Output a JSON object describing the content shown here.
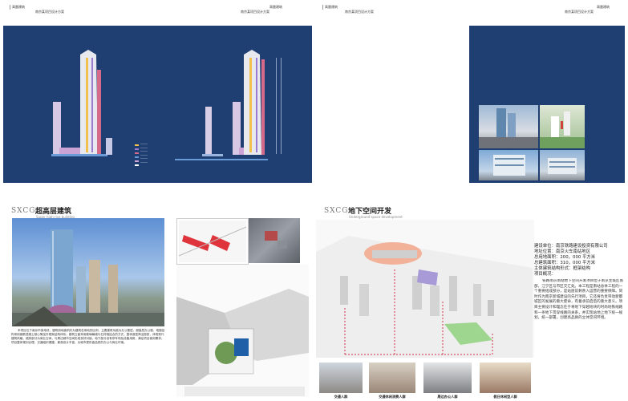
{
  "pages": {
    "elevation": {
      "header_left": "高層建筑",
      "header_right": "高層建筑",
      "header_note": "南京某项目设计方案",
      "legend": [
        "一一一",
        "一一一",
        "一一一",
        "一一一",
        "一一一",
        "一一一"
      ]
    },
    "renderings": {
      "header_left": "高層建筑",
      "header_right": "高層建筑",
      "header_note": "南京某项目设计方案"
    },
    "highrise": {
      "logo": "SXCG",
      "title": "超高层建筑",
      "subtitle": "Super high-rise building",
      "text": "本项目位于南京市某地块，建筑用地面积约为建筑总用地的比例，主要建筑功能为办公楼层。超高层办公楼，塔楼结构采用钢筋混凝土核心筒加外框架结构体系。建筑立面采用玻璃幕墙与石材相结合的方式，整体造型简洁挺拔，体现现代建筑风格。裙房部分为商业空间，与周边城市空间形成良好对接。地下部分设有停车场及设备用房，满足项目使用需求。项目整体规划合理，交通组织便捷，景观设计丰富，为城市提供高品质的办公与商业环境。"
    },
    "underground": {
      "logo": "SXCG",
      "title": "地下空间开发",
      "subtitle": "Underground space development",
      "info": [
        "建设单位：南京铁路建设投资有限公司",
        "地址位置：南京火车南站地区",
        "总用地面积：200，000 平方米",
        "总建筑面积：310，000 平方米",
        "主体建筑结构形式：框架结构",
        "项目概况："
      ],
      "description": "铁路南京南站地下空间开发项目位于南京主城区南部，江宁区与市区交汇处。本工程是南站总体工程的一个重要组成部分，是站屋前剩余入运营的重要保障。同时作为南京新城建设的先行项目，它还将负责带动新都城区的发展的重大使命，有着承前启后的重大意义。项目主要设计和理念在于将地下穿越地块的时尚地铁线路和一条地下贯穿线路的关系，并实现站地上地下统一规划，统一部署，创建高品质的立体空间环境。",
      "captions": [
        "交通人群",
        "交通休闲消费人群",
        "周边办公人群",
        "假日休闲型人群"
      ]
    }
  }
}
